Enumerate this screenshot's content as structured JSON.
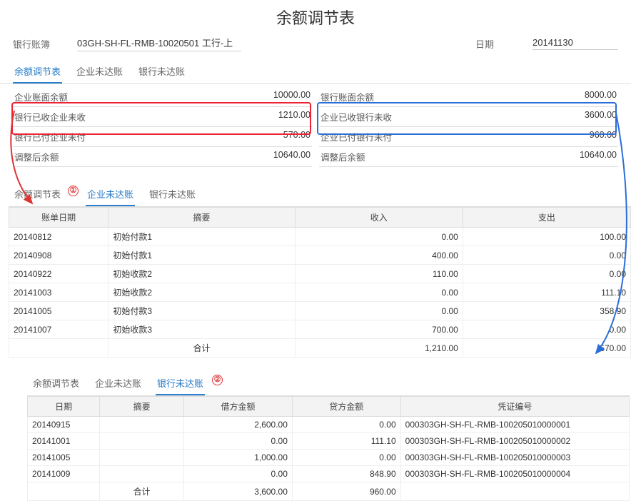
{
  "title": "余额调节表",
  "header": {
    "ledger_label": "银行账簿",
    "ledger_value": "03GH-SH-FL-RMB-10020501 工行-上",
    "date_label": "日期",
    "date_value": "20141130"
  },
  "tabs1": {
    "t0": "余额调节表",
    "t1": "企业未达账",
    "t2": "银行未达账"
  },
  "rec": {
    "left": {
      "r0l": "企业账面余额",
      "r0v": "10000.00",
      "r1l": "银行已收企业未收",
      "r1v": "1210.00",
      "r2l": "银行已付企业未付",
      "r2v": "570.00",
      "r3l": "调整后余额",
      "r3v": "10640.00"
    },
    "right": {
      "r0l": "银行账面余额",
      "r0v": "8000.00",
      "r1l": "企业已收银行未收",
      "r1v": "3600.00",
      "r2l": "企业已付银行未付",
      "r2v": "960.00",
      "r3l": "调整后余额",
      "r3v": "10640.00"
    }
  },
  "badge1": "①",
  "badge2": "②",
  "tabs2": {
    "t0": "余额调节表",
    "t1": "企业未达账",
    "t2": "银行未达账"
  },
  "table2": {
    "h0": "账单日期",
    "h1": "摘要",
    "h2": "收入",
    "h3": "支出",
    "rows": [
      {
        "d": "20140812",
        "s": "初始付款1",
        "in": "0.00",
        "out": "100.00"
      },
      {
        "d": "20140908",
        "s": "初始付款1",
        "in": "400.00",
        "out": "0.00"
      },
      {
        "d": "20140922",
        "s": "初始收款2",
        "in": "110.00",
        "out": "0.00"
      },
      {
        "d": "20141003",
        "s": "初始收款2",
        "in": "0.00",
        "out": "111.10"
      },
      {
        "d": "20141005",
        "s": "初始付款3",
        "in": "0.00",
        "out": "358.90"
      },
      {
        "d": "20141007",
        "s": "初始收款3",
        "in": "700.00",
        "out": "0.00"
      }
    ],
    "total_label": "合计",
    "total_in": "1,210.00",
    "total_out": "570.00"
  },
  "tabs3": {
    "t0": "余额调节表",
    "t1": "企业未达账",
    "t2": "银行未达账"
  },
  "table3": {
    "h0": "日期",
    "h1": "摘要",
    "h2": "借方金额",
    "h3": "贷方金额",
    "h4": "凭证编号",
    "rows": [
      {
        "d": "20140915",
        "s": "",
        "dr": "2,600.00",
        "cr": "0.00",
        "v": "000303GH-SH-FL-RMB-100205010000001"
      },
      {
        "d": "20141001",
        "s": "",
        "dr": "0.00",
        "cr": "111.10",
        "v": "000303GH-SH-FL-RMB-100205010000002"
      },
      {
        "d": "20141005",
        "s": "",
        "dr": "1,000.00",
        "cr": "0.00",
        "v": "000303GH-SH-FL-RMB-100205010000003"
      },
      {
        "d": "20141009",
        "s": "",
        "dr": "0.00",
        "cr": "848.90",
        "v": "000303GH-SH-FL-RMB-100205010000004"
      }
    ],
    "total_label": "合计",
    "total_dr": "3,600.00",
    "total_cr": "960.00"
  }
}
